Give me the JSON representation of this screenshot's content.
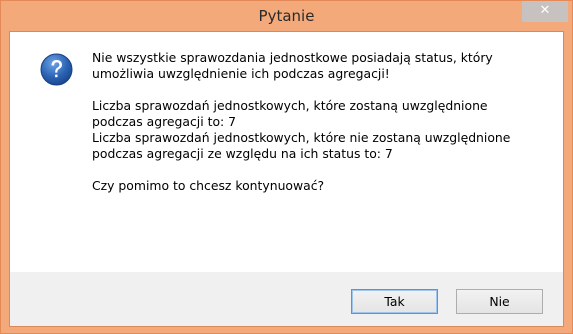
{
  "dialog": {
    "title": "Pytanie",
    "close_glyph": "✕",
    "icon": "question-icon",
    "message": {
      "line1": "Nie wszystkie sprawozdania jednostkowe posiadają status, który",
      "line2": "umożliwia uwzględnienie ich podczas agregacji!",
      "line3": "Liczba sprawozdań jednostkowych, które zostaną uwzględnione",
      "line4": "podczas agregacji to: 7",
      "line5": "Liczba sprawozdań jednostkowych, które nie zostaną uwzględnione",
      "line6": "podczas agregacji ze względu na ich status to: 7",
      "line7": "Czy pomimo to chcesz kontynuować?"
    },
    "buttons": {
      "yes": "Tak",
      "no": "Nie"
    }
  },
  "colors": {
    "titlebar": "#f4a97a",
    "close_button": "#c7c2c0",
    "icon_blue": "#2a63b4"
  }
}
